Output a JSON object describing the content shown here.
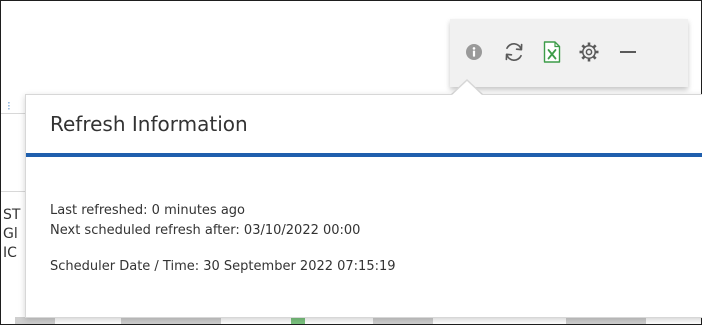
{
  "toolbar": {
    "buttons": [
      {
        "id": "info",
        "icon": "info-icon",
        "color": "#9a9a9a"
      },
      {
        "id": "refresh",
        "icon": "refresh-icon",
        "color": "#5a5a5a"
      },
      {
        "id": "export",
        "icon": "excel-icon",
        "color": "#3c9c48"
      },
      {
        "id": "settings",
        "icon": "gear-icon",
        "color": "#5a5a5a"
      },
      {
        "id": "minimize",
        "icon": "minimize-icon",
        "color": "#5a5a5a"
      }
    ]
  },
  "popup": {
    "title": "Refresh Information",
    "last_refreshed": "Last refreshed: 0 minutes ago",
    "next_refresh": "Next scheduled refresh after: 03/10/2022 00:00",
    "scheduler_datetime": "Scheduler Date / Time: 30 September 2022 07:15:19",
    "accent_color": "#1f5fad"
  },
  "background": {
    "fragments": [
      "ST",
      "Gl",
      "IC"
    ]
  }
}
